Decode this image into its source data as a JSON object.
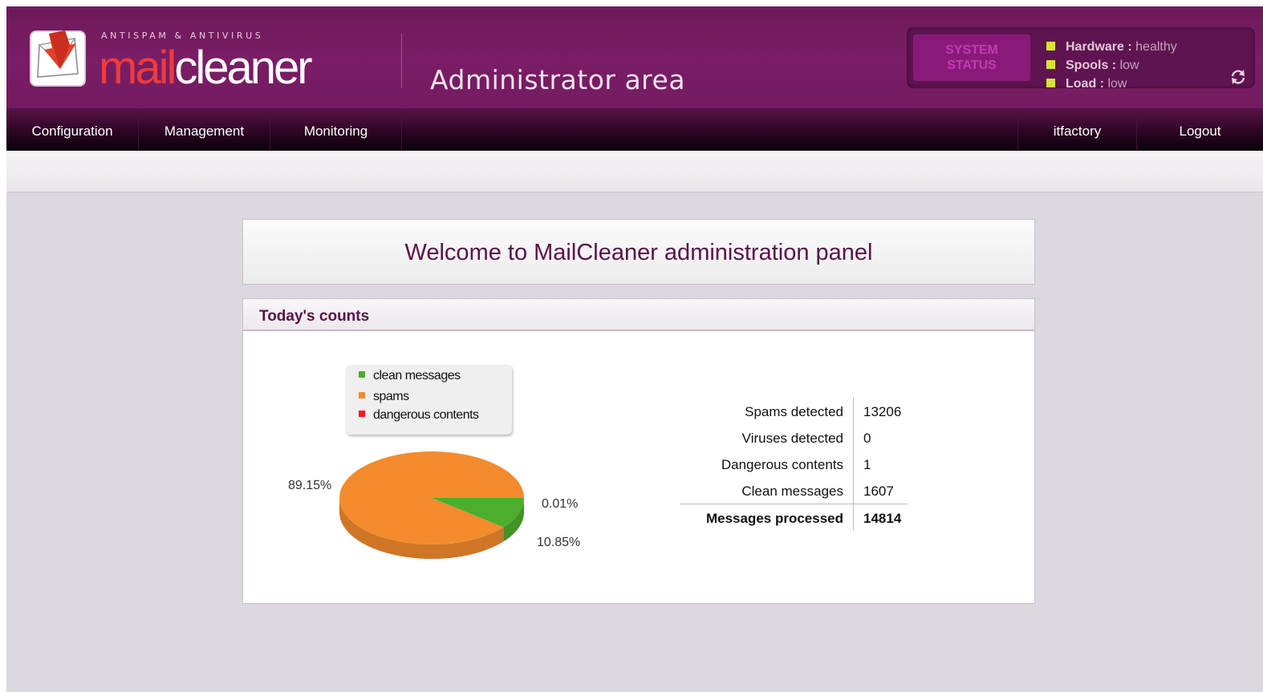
{
  "header": {
    "logo_tagline": "ANTISPAM & ANTIVIRUS",
    "logo_mail": "mail",
    "logo_cleaner": "cleaner",
    "title": "Administrator area"
  },
  "system_status": {
    "label_line1": "SYSTEM",
    "label_line2": "STATUS",
    "items": [
      {
        "key": "Hardware :",
        "value": "healthy",
        "led_color": "#d6e42c"
      },
      {
        "key": "Spools :",
        "value": "low",
        "led_color": "#d6e42c"
      },
      {
        "key": "Load :",
        "value": "low",
        "led_color": "#d6e42c"
      }
    ],
    "refresh_icon": "refresh-icon"
  },
  "nav": {
    "left": [
      "Configuration",
      "Management",
      "Monitoring"
    ],
    "user": "itfactory",
    "logout": "Logout"
  },
  "welcome": {
    "text": "Welcome to MailCleaner administration panel"
  },
  "counts": {
    "title": "Today's counts",
    "legend": [
      {
        "label": "clean messages",
        "color": "#4cae2d"
      },
      {
        "label": "spams",
        "color": "#f38b2d"
      },
      {
        "label": "dangerous contents",
        "color": "#ee1c1c"
      }
    ],
    "pie_labels": {
      "spams": "89.15%",
      "dangerous": "0.01%",
      "clean": "10.85%"
    },
    "stats": [
      {
        "label": "Spams detected",
        "value": "13206"
      },
      {
        "label": "Viruses detected",
        "value": "0"
      },
      {
        "label": "Dangerous contents",
        "value": "1"
      },
      {
        "label": "Clean messages",
        "value": "1607"
      }
    ],
    "total": {
      "label": "Messages processed",
      "value": "14814"
    }
  },
  "chart_data": {
    "type": "pie",
    "categories": [
      "clean messages",
      "spams",
      "dangerous contents"
    ],
    "values": [
      10.85,
      89.15,
      0.01
    ],
    "colors": [
      "#4cae2d",
      "#f38b2d",
      "#ee1c1c"
    ],
    "legend_position": "top"
  }
}
